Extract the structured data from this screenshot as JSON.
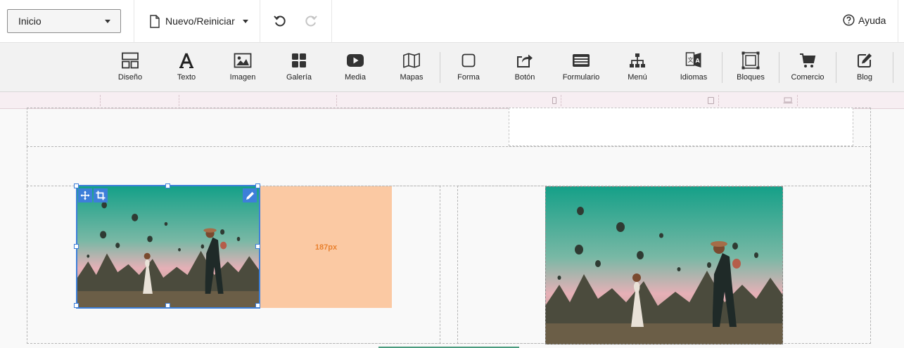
{
  "header": {
    "page_select": "Inicio",
    "new_label": "Nuevo/Reiniciar",
    "help_label": "Ayuda"
  },
  "toolbar": {
    "items": [
      {
        "label": "Diseño",
        "icon": "layout-icon"
      },
      {
        "label": "Texto",
        "icon": "text-icon"
      },
      {
        "label": "Imagen",
        "icon": "image-icon"
      },
      {
        "label": "Galería",
        "icon": "gallery-icon"
      },
      {
        "label": "Media",
        "icon": "media-icon"
      },
      {
        "label": "Mapas",
        "icon": "map-icon"
      },
      {
        "label": "Forma",
        "icon": "shape-icon"
      },
      {
        "label": "Botón",
        "icon": "button-icon"
      },
      {
        "label": "Formulario",
        "icon": "form-icon"
      },
      {
        "label": "Menú",
        "icon": "menu-icon"
      },
      {
        "label": "Idiomas",
        "icon": "languages-icon"
      },
      {
        "label": "Bloques",
        "icon": "blocks-icon"
      },
      {
        "label": "Comercio",
        "icon": "cart-icon"
      },
      {
        "label": "Blog",
        "icon": "blog-icon"
      }
    ]
  },
  "canvas": {
    "spacer_label": "187px"
  },
  "colors": {
    "selection": "#3d7fd9",
    "spacer_bg": "#fbc9a3",
    "spacer_text": "#e9812f",
    "ruler_bg": "#f7eef2"
  }
}
